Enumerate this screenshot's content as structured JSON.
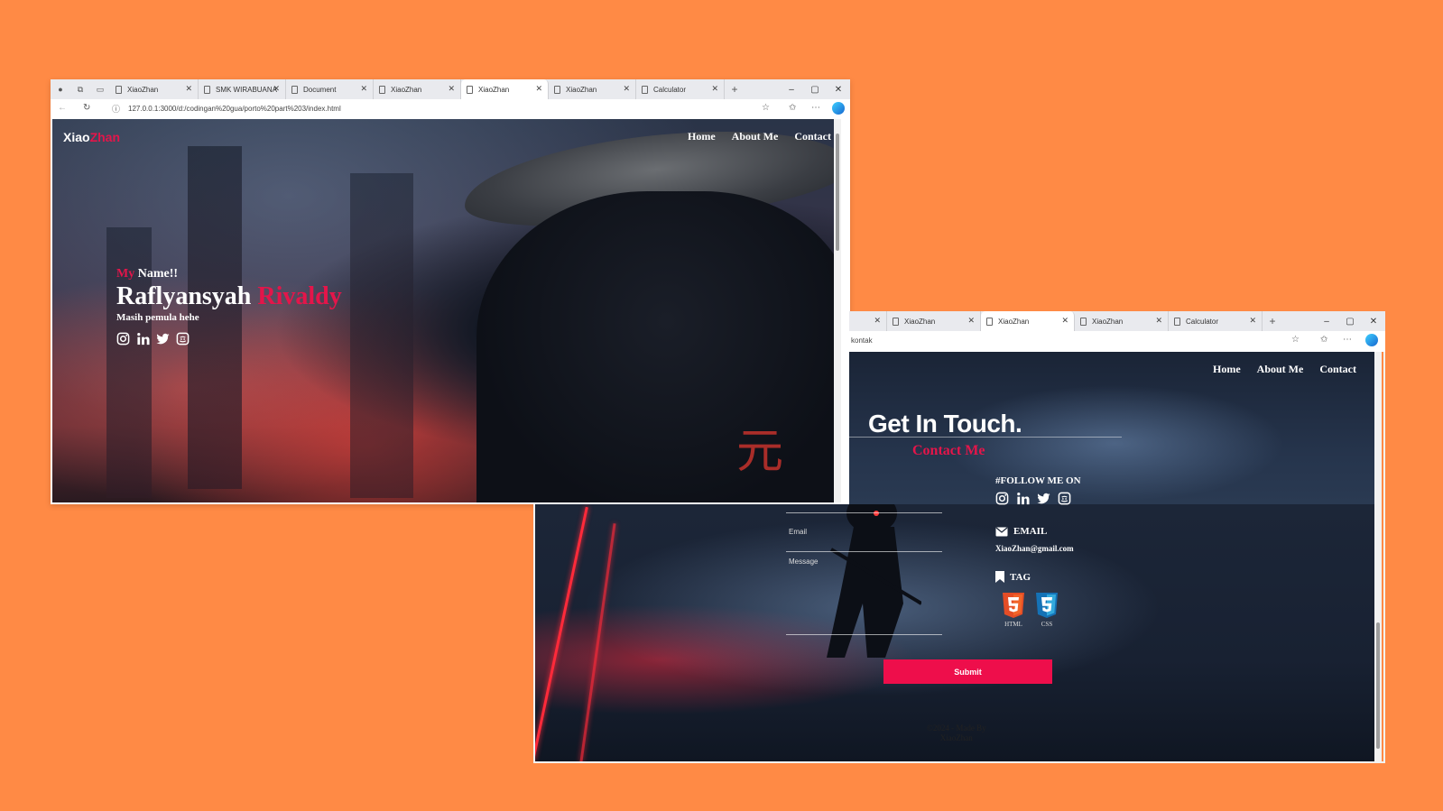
{
  "colors": {
    "background": "#ff8a45",
    "accent": "#e4154a",
    "submit": "#ee0e4b"
  },
  "window1": {
    "tabs": [
      {
        "label": "XiaoZhan",
        "active": false
      },
      {
        "label": "SMK WIRABUANA",
        "active": false
      },
      {
        "label": "Document",
        "active": false
      },
      {
        "label": "XiaoZhan",
        "active": false
      },
      {
        "label": "XiaoZhan",
        "active": true
      },
      {
        "label": "XiaoZhan",
        "active": false
      },
      {
        "label": "Calculator",
        "active": false
      }
    ],
    "url": "127.0.0.1:3000/d:/codingan%20gua/porto%20part%203/index.html",
    "page": {
      "brand_main": "Xiao",
      "brand_accent": "Zhan",
      "nav": [
        "Home",
        "About Me",
        "Contact"
      ],
      "intro_prefix": "My",
      "intro_rest": " Name!!",
      "name_first": "Raflyansyah",
      "name_last": "Rivaldy",
      "tagline": "Masih pemula hehe",
      "socials": [
        "instagram-icon",
        "linkedin-icon",
        "twitter-icon",
        "discord-icon"
      ],
      "image_glyph": "元"
    }
  },
  "window2": {
    "tabs": [
      {
        "label": "",
        "active": false
      },
      {
        "label": "XiaoZhan",
        "active": false
      },
      {
        "label": "XiaoZhan",
        "active": true
      },
      {
        "label": "XiaoZhan",
        "active": false
      },
      {
        "label": "Calculator",
        "active": false
      }
    ],
    "url": "kontak",
    "page": {
      "nav": [
        "Home",
        "About Me",
        "Contact"
      ],
      "heading": "Get In Touch.",
      "subheading": "Contact Me",
      "follow_label": "#FOLLOW ME ON",
      "socials": [
        "instagram-icon",
        "linkedin-icon",
        "twitter-icon",
        "discord-icon"
      ],
      "email_label": "EMAIL",
      "email_value": "XiaoZhan@gmail.com",
      "tag_label": "TAG",
      "tags": [
        {
          "label": "HTML",
          "icon": "html5-icon"
        },
        {
          "label": "CSS",
          "icon": "css3-icon"
        }
      ],
      "email_field_label": "Email",
      "message_field_label": "Message",
      "submit_label": "Submit",
      "footer_line1": "©2024 - Made By",
      "footer_line2": "XiaoZhan"
    }
  }
}
